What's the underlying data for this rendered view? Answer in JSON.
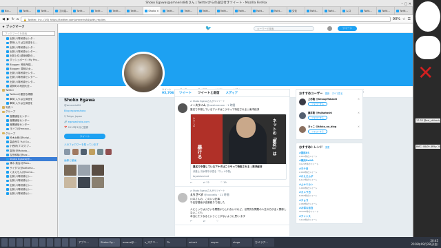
{
  "window": {
    "title": "Shoko Egawa(@amneris84)さん | Twitterからの返信付きツイート - Mozilla Firefox",
    "controls": "–  ▢  ✕"
  },
  "tabs": [
    {
      "label": "Blo..."
    },
    {
      "label": "Twitt..."
    },
    {
      "label": "Twitt..."
    },
    {
      "label": "江川紹..."
    },
    {
      "label": "Twitt..."
    },
    {
      "label": "Twitt..."
    },
    {
      "label": "Twitt..."
    },
    {
      "label": "Twitt..."
    },
    {
      "label": "Shoko ×"
    },
    {
      "label": "Twitt..."
    },
    {
      "label": "Twitt..."
    },
    {
      "label": "Twitt..."
    },
    {
      "label": "Twitt..."
    },
    {
      "label": "Twitt..."
    },
    {
      "label": "Twitt..."
    },
    {
      "label": "Twitt..."
    },
    {
      "label": "文化"
    },
    {
      "label": "Twitt..."
    },
    {
      "label": "Twitt..."
    },
    {
      "label": "人口"
    },
    {
      "label": "Twitt..."
    },
    {
      "label": "Twitt..."
    },
    {
      "label": "Twitt..."
    }
  ],
  "url": {
    "site_badge": "Twitter, Inc. (US)",
    "value": "https://twitter.com/amneris84/with_replies",
    "zoom": "90%"
  },
  "sidebar": {
    "header": "ブックマーク",
    "search_placeholder": "ブックマークを検索",
    "items": [
      {
        "label": "出発:川場吊橋センタ...",
        "folder": false
      },
      {
        "label": "車椅:入りは立体図をと...",
        "folder": false
      },
      {
        "label": "出発:川場吊橋センタ...",
        "folder": false
      },
      {
        "label": "出発:川場吊橋センター...",
        "folder": false
      },
      {
        "label": "出発上位:越後線駅の...",
        "folder": false
      },
      {
        "label": "ダッシュボード: My Pro...",
        "folder": false
      },
      {
        "label": "Blogger: 神田吊橋...",
        "folder": false
      },
      {
        "label": "Blogger: 車椅の女...",
        "folder": false
      },
      {
        "label": "出発:川場吊橋センタ...",
        "folder": false
      },
      {
        "label": "出発:川場吊橋センター...",
        "folder": false
      },
      {
        "label": "出発:川場吊橋センタ...",
        "folder": false
      },
      {
        "label": "能勢町の地図大全...",
        "folder": false
      },
      {
        "label": "Twitter",
        "folder": true
      },
      {
        "label": "Twitterの運営な規模",
        "folder": false
      },
      {
        "label": "車椅 入りは立体図を",
        "folder": false
      },
      {
        "label": "車椅 入りは立体図を",
        "folder": false
      },
      {
        "label": "写真 1",
        "folder": true
      },
      {
        "label": "グループ",
        "folder": true
      },
      {
        "label": "音響通信センター",
        "folder": false
      },
      {
        "label": "音響通信センター",
        "folder": false
      },
      {
        "label": "音響通信センター",
        "folder": false
      },
      {
        "label": "ヨトワ(@mezoo...",
        "folder": false
      },
      {
        "label": "グループ",
        "folder": true
      },
      {
        "label": "鈴木太郎(@kaigi...",
        "folder": false
      },
      {
        "label": "高倉良平 Yuji Gu...",
        "folder": false
      },
      {
        "label": "小西研(ブログ)プ...",
        "folder": false
      },
      {
        "label": "富田(@Makoto...",
        "folder": false
      },
      {
        "label": "吉田和裕(@kaz...",
        "folder": false
      },
      {
        "label": "Shoko Egawa(@...",
        "folder": false,
        "selected": true
      },
      {
        "label": "清水 英治(@Raw...",
        "folder": false
      },
      {
        "label": "サイタマ(@saitama...",
        "folder": false
      },
      {
        "label": "くまえもん(@kuma...",
        "folder": false
      },
      {
        "label": "出発:川場吊橋セン...",
        "folder": false
      },
      {
        "label": "出発:川場吊橋セン...",
        "folder": false
      },
      {
        "label": "出発:川場吊橋セン...",
        "folder": false
      },
      {
        "label": "出発:川場吊橋セン...",
        "folder": false
      },
      {
        "label": "出発:川場吊橋セン...",
        "folder": false
      }
    ]
  },
  "twitter": {
    "search_placeholder": "キーワード検索",
    "tweet_button": "ツイート",
    "stats": [
      {
        "label": "ツイート",
        "value": "95,706"
      },
      {
        "label": "フォロー",
        "value": "569"
      },
      {
        "label": "フォロワー",
        "value": "273,898"
      },
      {
        "label": "いいね",
        "value": "6,334"
      },
      {
        "label": "リスト",
        "value": "2"
      }
    ],
    "follow_button": "フォローする",
    "profile": {
      "name": "Shoko Egawa",
      "handle": "@amneris84",
      "blog": "Blog egawashoko",
      "location": "Tokyo, Japan",
      "website": "egawashoko.com",
      "joined": "2010年1月に登録",
      "tweet_to": "ツイート",
      "followers_you_know": "人のフォロワーを知っています",
      "photos_videos": "画像と動画"
    },
    "timeline_tabs": [
      "ツイート",
      "ツイートと返信",
      "メディア"
    ],
    "tweets": [
      {
        "pinned": "Shoko Egawaさんがリツイート",
        "author": "ノースライム",
        "handle": "@noslimecom",
        "time": "1 時間",
        "text": "裏名で中傷しているアナタはこうやって特定される | 東洋経済",
        "card_title": "裏名で中傷しているアナタはこうやって特定される | 東洋経済",
        "card_desc": "弁護士 清水陽平が語る「ネット中傷」",
        "card_vertical": "ネットの「匿名」は",
        "card_badge": "シリーズ",
        "card_big": "暴ける",
        "card_domain": "toyokeizai.net",
        "actions": [
          "↩",
          "⇄ 12",
          "♡ 19"
        ]
      },
      {
        "pinned": "Shoko Egawaさんがリツイート",
        "author": "えりざべす",
        "handle": "@cocoelis",
        "time": "11 時間",
        "text": "川口さんの、このいい記事\n千佳容疑者が言葉殴りで殺した\n\n人にとっては小さいな問題かもしれないけれど、世界的な問題の人生の方が全く関係しないことも\n本当にそうなるということがないように思い ます",
        "actions": [
          "↩",
          "⇄",
          "♡"
        ]
      }
    ],
    "who_to_follow": {
      "title": "おすすめユーザー",
      "refresh": "更新",
      "view_all": "すべて見る",
      "users": [
        {
          "name": "上杉隆 @UesugiTakashi",
          "button": "フォローする"
        },
        {
          "name": "藤井聡 @fujisatoshi",
          "button": "フォローする"
        },
        {
          "name": "きっこ @kikko_no_blog",
          "button": "フォローする"
        }
      ]
    },
    "trends": {
      "title": "おすすめトレンド",
      "change": "変更",
      "items": [
        {
          "name": "#国民ES",
          "count": "2,041件のツイート"
        },
        {
          "name": "#横浜DeNA",
          "count": "14,225件のツイート"
        },
        {
          "name": "#ホケ日",
          "count": "2,046件のツイート"
        },
        {
          "name": "#かえさんが",
          "count": "6,147件のツイート"
        },
        {
          "name": "#ムヤミカン",
          "count": "1,000件のツイート"
        },
        {
          "name": "#カメラ日",
          "count": "8,065件のツイート"
        },
        {
          "name": "#チョコ",
          "count": "2,088件のツイート"
        },
        {
          "name": "#お得な目白",
          "count": "20,600件のツイート"
        },
        {
          "name": "#チャンス",
          "count": "3,104件のツイート"
        }
      ]
    }
  },
  "taskbar": {
    "items": [
      "アプリ...",
      "Shoko Eg...",
      "emacs@...",
      "s_スクリ...",
      "Tk",
      "xclock",
      "xeyes",
      "xlogo",
      "カメラア..."
    ],
    "clock_time": "20:45",
    "clock_date": "2018年09月28日(金)"
  },
  "desktop": {
    "snippet_1": "17:33 @aoi_shiina.k, Pa-...",
    "snippet_2": "RiflCi 08/09 (Rflty 20/7/4"
  }
}
